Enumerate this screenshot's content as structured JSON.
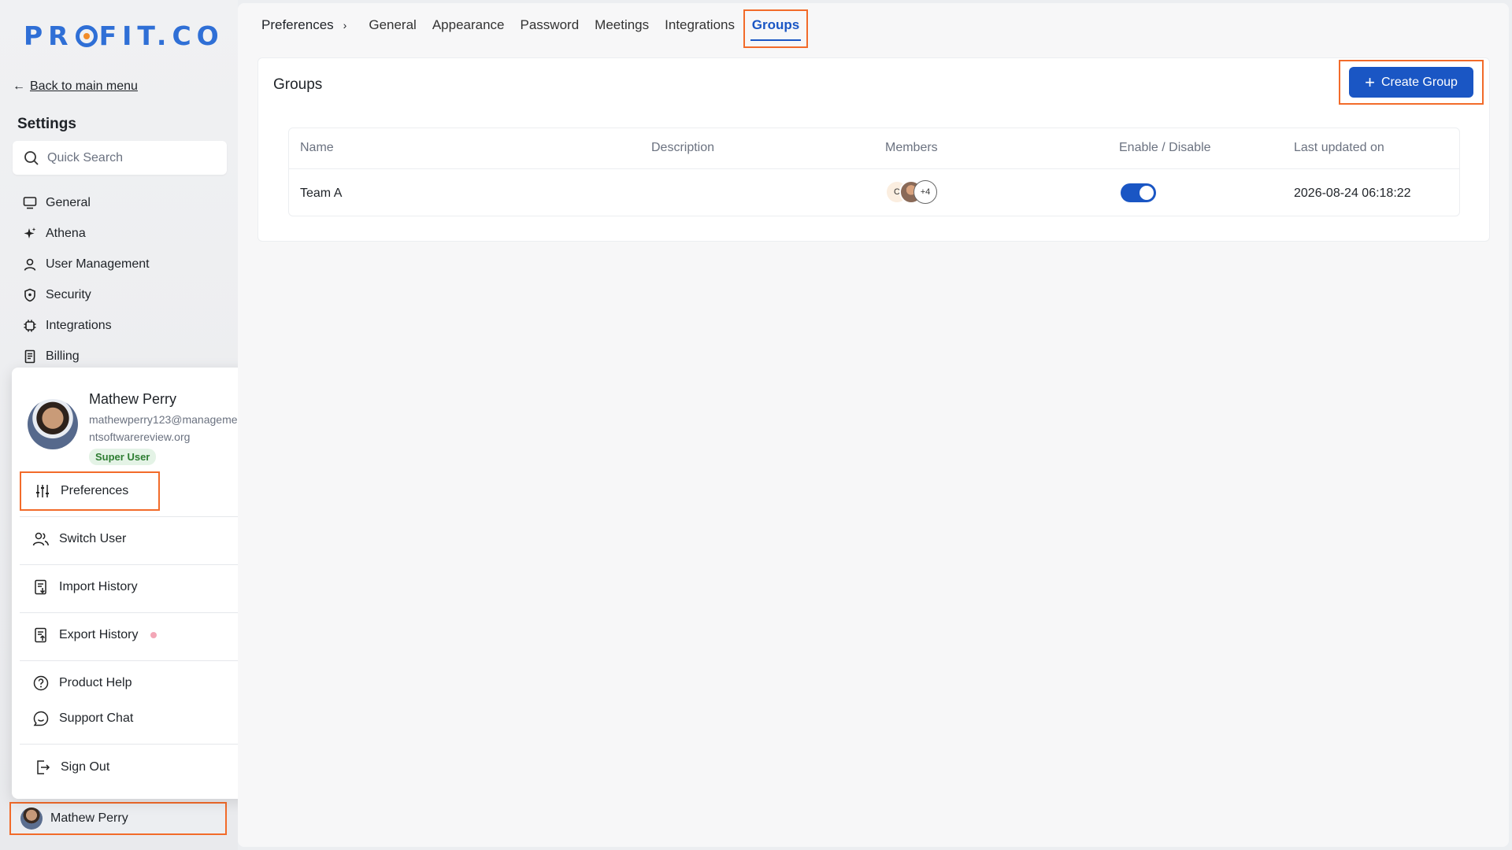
{
  "sidebar": {
    "logo": "PROFIT.CO",
    "back_label": "Back to main menu",
    "section_title": "Settings",
    "search_placeholder": "Quick Search",
    "items": [
      {
        "label": "General",
        "icon": "monitor-icon"
      },
      {
        "label": "Athena",
        "icon": "sparkle-icon"
      },
      {
        "label": "User Management",
        "icon": "user-icon"
      },
      {
        "label": "Security",
        "icon": "shield-icon"
      },
      {
        "label": "Integrations",
        "icon": "chip-icon"
      },
      {
        "label": "Billing",
        "icon": "receipt-icon"
      }
    ],
    "user_name": "Mathew Perry"
  },
  "menu": {
    "name": "Mathew Perry",
    "email": "mathewperry123@managementsoftwarereview.org",
    "role": "Super User",
    "items": [
      {
        "label": "Preferences",
        "icon": "sliders-icon"
      },
      {
        "label": "Switch User",
        "icon": "users-icon"
      },
      {
        "label": "Import History",
        "icon": "import-doc-icon"
      },
      {
        "label": "Export History",
        "icon": "export-doc-icon"
      },
      {
        "label": "Product Help",
        "icon": "help-circle-icon"
      },
      {
        "label": "Support Chat",
        "icon": "chat-icon"
      },
      {
        "label": "Sign Out",
        "icon": "sign-out-icon"
      }
    ]
  },
  "header": {
    "breadcrumb": "Preferences",
    "tabs": [
      "General",
      "Appearance",
      "Password",
      "Meetings",
      "Integrations"
    ],
    "active_tab": "Groups"
  },
  "groups": {
    "title": "Groups",
    "create_label": "Create Group",
    "columns": [
      "Name",
      "Description",
      "Members",
      "Enable / Disable",
      "Last updated on"
    ],
    "rows": [
      {
        "name": "Team A",
        "description": "",
        "members_initial": "C",
        "members_more": "+4",
        "enabled": true,
        "updated": "2026-08-24 06:18:22"
      }
    ]
  },
  "colors": {
    "accent": "#1a56c4",
    "highlight": "#f26b2a"
  }
}
